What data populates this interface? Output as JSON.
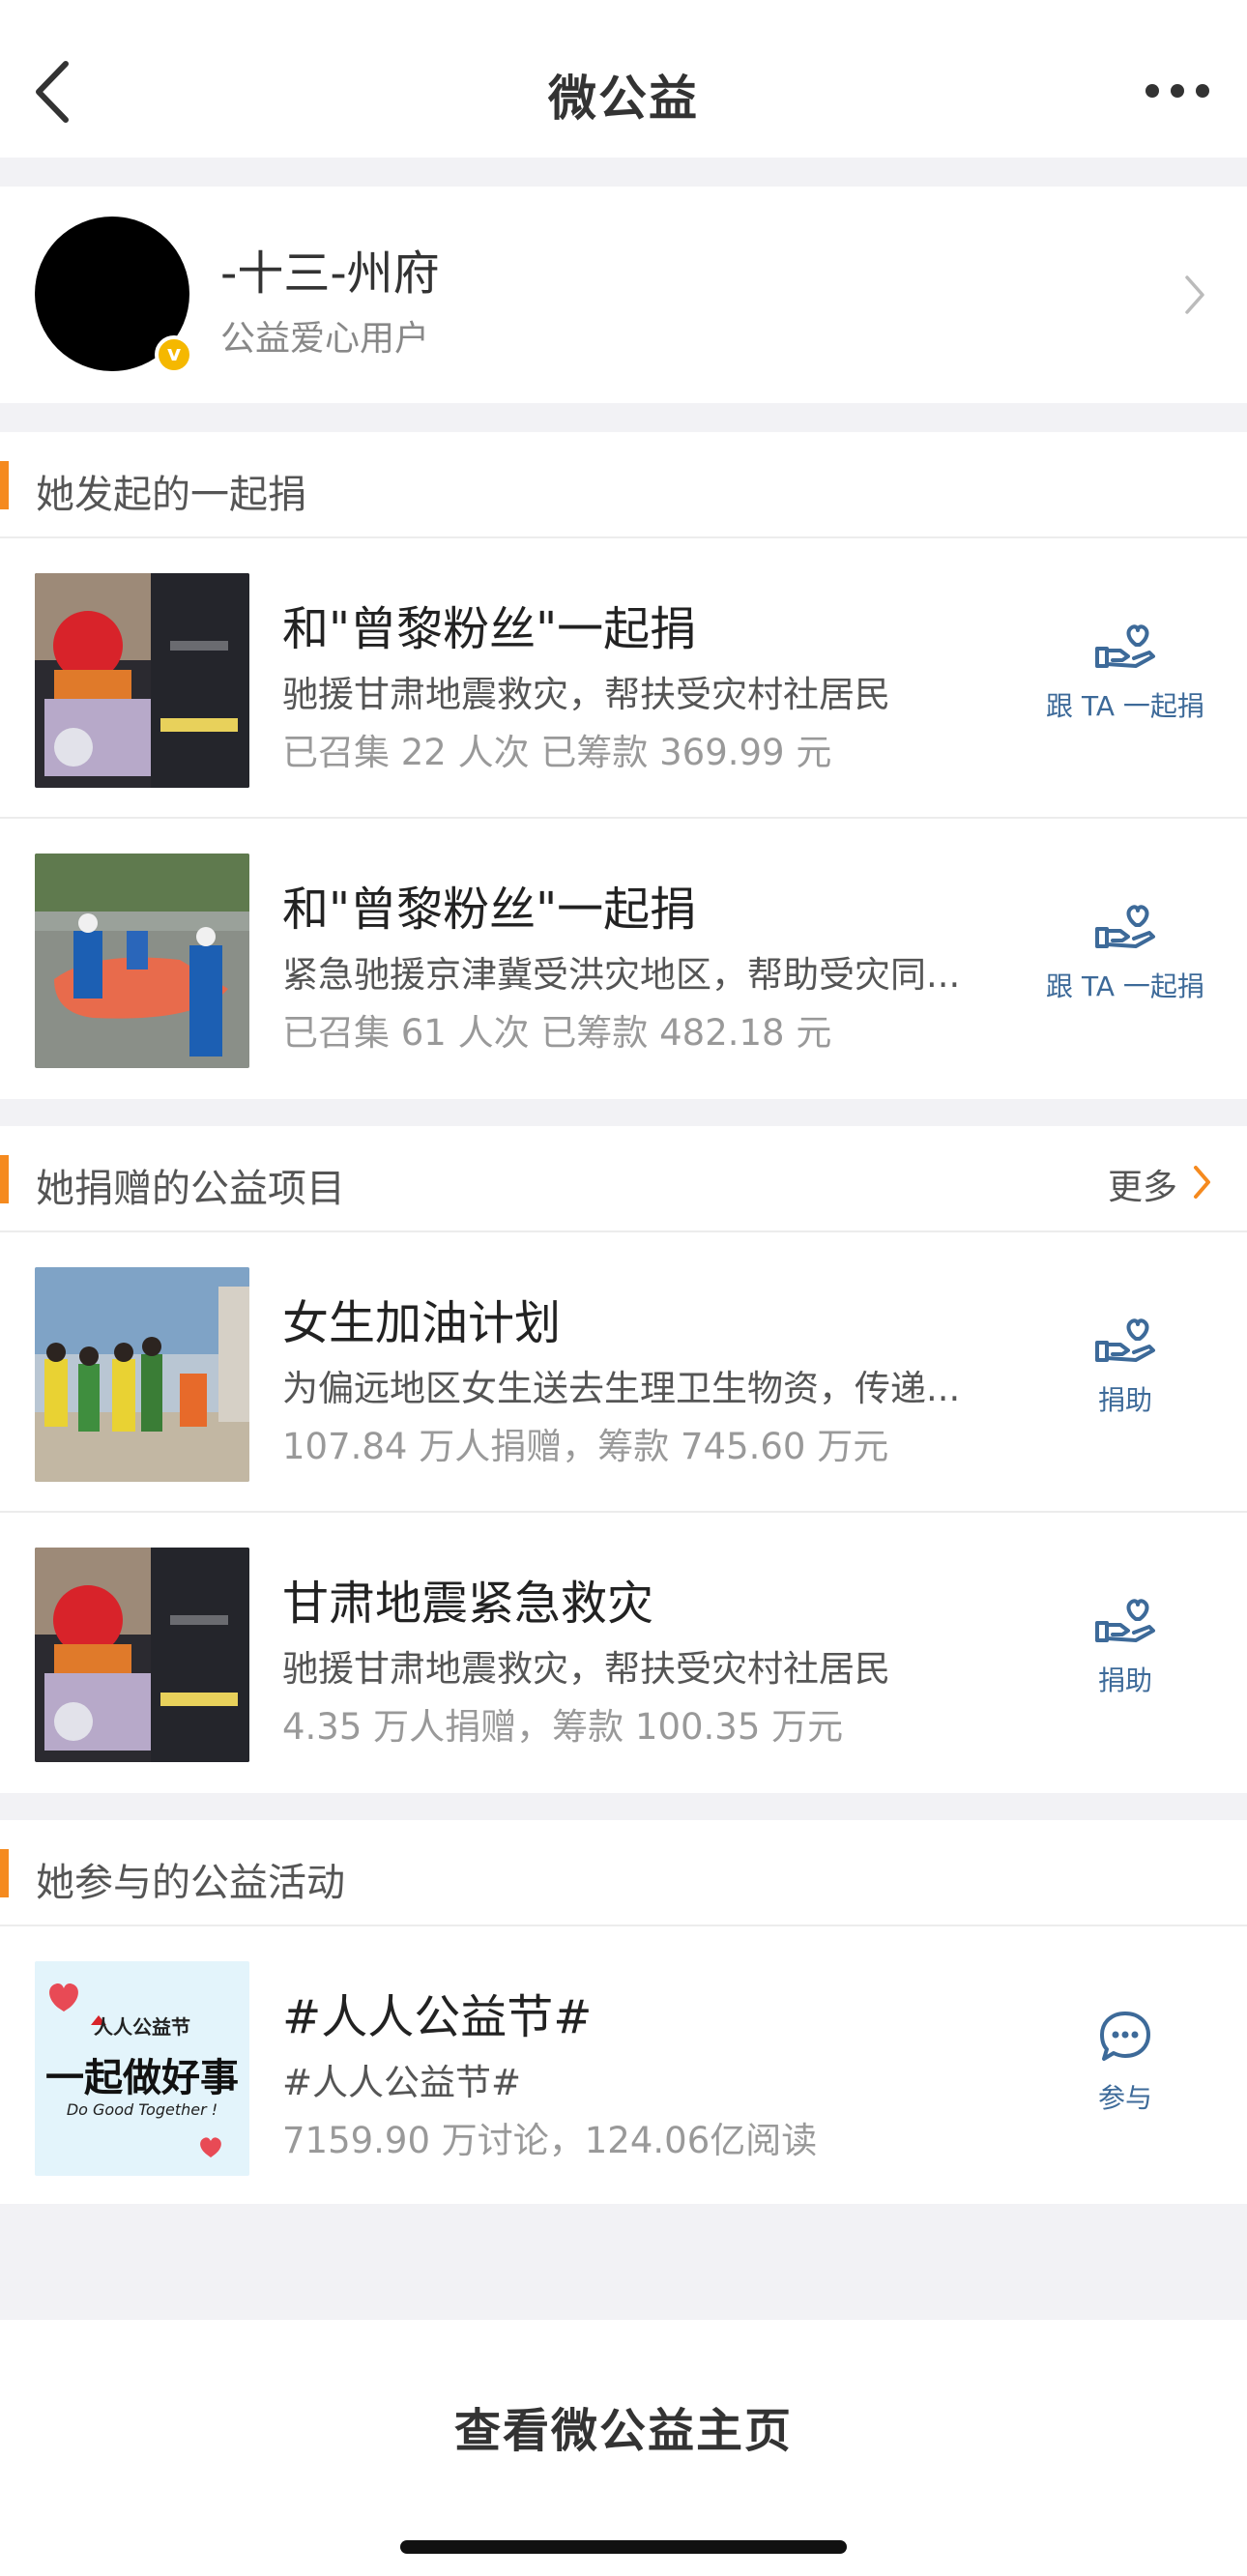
{
  "nav": {
    "title": "微公益"
  },
  "profile": {
    "name": "-十三-州府",
    "subtitle": "公益爱心用户",
    "badge": "v"
  },
  "section_initiated": {
    "title": "她发起的一起捐",
    "items": [
      {
        "title": "和\"曾黎粉丝\"一起捐",
        "desc": "驰援甘肃地震救灾，帮扶受灾村社居民",
        "stats": "已召集 22 人次 已筹款 369.99 元",
        "action": "跟 TA 一起捐"
      },
      {
        "title": "和\"曾黎粉丝\"一起捐",
        "desc": "紧急驰援京津冀受洪灾地区，帮助受灾同...",
        "stats": "已召集 61 人次 已筹款 482.18 元",
        "action": "跟 TA 一起捐"
      }
    ]
  },
  "section_donated": {
    "title": "她捐赠的公益项目",
    "more": "更多",
    "items": [
      {
        "title": "女生加油计划",
        "desc": "为偏远地区女生送去生理卫生物资，传递...",
        "stats": "107.84 万人捐赠，筹款 745.60 万元",
        "action": "捐助"
      },
      {
        "title": "甘肃地震紧急救灾",
        "desc": "驰援甘肃地震救灾，帮扶受灾村社居民",
        "stats": "4.35 万人捐赠，筹款 100.35 万元",
        "action": "捐助"
      }
    ]
  },
  "section_activities": {
    "title": "她参与的公益活动",
    "items": [
      {
        "title": "#人人公益节#",
        "desc": "#人人公益节#",
        "stats": "7159.90 万讨论，124.06亿阅读",
        "action": "参与",
        "thumb_brand": "人人公益节",
        "thumb_slogan": "一起做好事",
        "thumb_en": "Do Good Together !"
      }
    ]
  },
  "bottom": {
    "link": "查看微公益主页"
  },
  "colors": {
    "accent": "#f58a1f",
    "action_blue": "#3d6a99",
    "background": "#f2f2f5"
  },
  "icons": {
    "back": "back-arrow-icon",
    "more": "more-dots-icon",
    "donate": "hand-heart-icon",
    "chat": "chat-bubble-icon"
  }
}
